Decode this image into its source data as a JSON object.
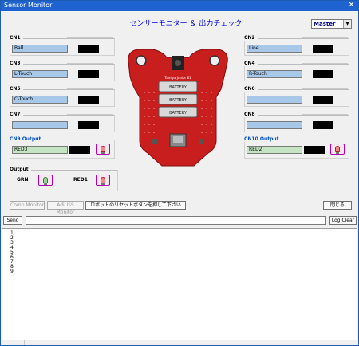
{
  "window": {
    "title": "Sensor Monitor",
    "close_glyph": "✕"
  },
  "heading": "センサーモニター ＆ 出力チェック",
  "mode": {
    "selected": "Master"
  },
  "board": {
    "label": "Tamiya Junior 81",
    "battery_label": "BATTERY"
  },
  "channels": [
    {
      "id": "cn1",
      "label": "CN1",
      "name": "Ball",
      "color": "#a8c8ea"
    },
    {
      "id": "cn2",
      "label": "CN2",
      "name": "Line",
      "color": "#a8c8ea"
    },
    {
      "id": "cn3",
      "label": "CN3",
      "name": "L-Touch",
      "color": "#a8c8ea"
    },
    {
      "id": "cn4",
      "label": "CN4",
      "name": "R-Touch",
      "color": "#a8c8ea"
    },
    {
      "id": "cn5",
      "label": "CN5",
      "name": "C-Touch",
      "color": "#a8c8ea"
    },
    {
      "id": "cn6",
      "label": "CN6",
      "name": "",
      "color": "#a8c8ea"
    },
    {
      "id": "cn7",
      "label": "CN7",
      "name": "",
      "color": "#a8c8ea"
    },
    {
      "id": "cn8",
      "label": "CN8",
      "name": "",
      "color": "#a8c8ea"
    }
  ],
  "outputs": [
    {
      "id": "cn9",
      "label": "CN9 Output",
      "name": "RED3"
    },
    {
      "id": "cn10",
      "label": "CN10 Output",
      "name": "RED2"
    }
  ],
  "output_group": {
    "label": "Output",
    "green_label": "GRN",
    "red_label": "RED1"
  },
  "buttons": {
    "comp_monitor": "Comp.Monitor",
    "adiuss_monitor": "AdiUSS Monitor",
    "reset_prompt": "ロボットのリセットボタンを押して下さい",
    "close": "閉じる",
    "send": "Send",
    "log_clear": "Log Clear"
  },
  "log_lines": [
    "1",
    "2",
    "3",
    "4",
    "5",
    "6",
    "7",
    "8",
    "9"
  ]
}
